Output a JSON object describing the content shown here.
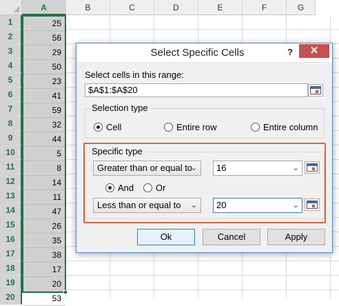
{
  "sheet": {
    "columns": [
      "A",
      "B",
      "C",
      "D",
      "E",
      "F",
      "G"
    ],
    "rows": [
      "1",
      "2",
      "3",
      "4",
      "5",
      "6",
      "7",
      "8",
      "9",
      "10",
      "11",
      "12",
      "13",
      "14",
      "15",
      "16",
      "17",
      "18",
      "19",
      "20"
    ],
    "values": [
      "25",
      "56",
      "29",
      "50",
      "23",
      "41",
      "59",
      "32",
      "44",
      "5",
      "8",
      "14",
      "11",
      "47",
      "26",
      "35",
      "38",
      "17",
      "20",
      "53"
    ]
  },
  "dialog": {
    "title": "Select Specific Cells",
    "help": "?",
    "close": "✕",
    "range_label": "Select cells in this range:",
    "range_value": "$A$1:$A$20",
    "selection_type": {
      "title": "Selection type",
      "options": [
        "Cell",
        "Entire row",
        "Entire column"
      ],
      "selected": "Cell"
    },
    "specific_type": {
      "title": "Specific type",
      "condition1": "Greater than or equal to",
      "value1": "16",
      "and_label": "And",
      "or_label": "Or",
      "logic_selected": "And",
      "condition2": "Less than or equal to",
      "value2": "20"
    },
    "buttons": {
      "ok": "Ok",
      "cancel": "Cancel",
      "apply": "Apply"
    }
  },
  "colors": {
    "accent_green": "#217346",
    "highlight": "#e2603b",
    "close_red": "#c75050"
  }
}
